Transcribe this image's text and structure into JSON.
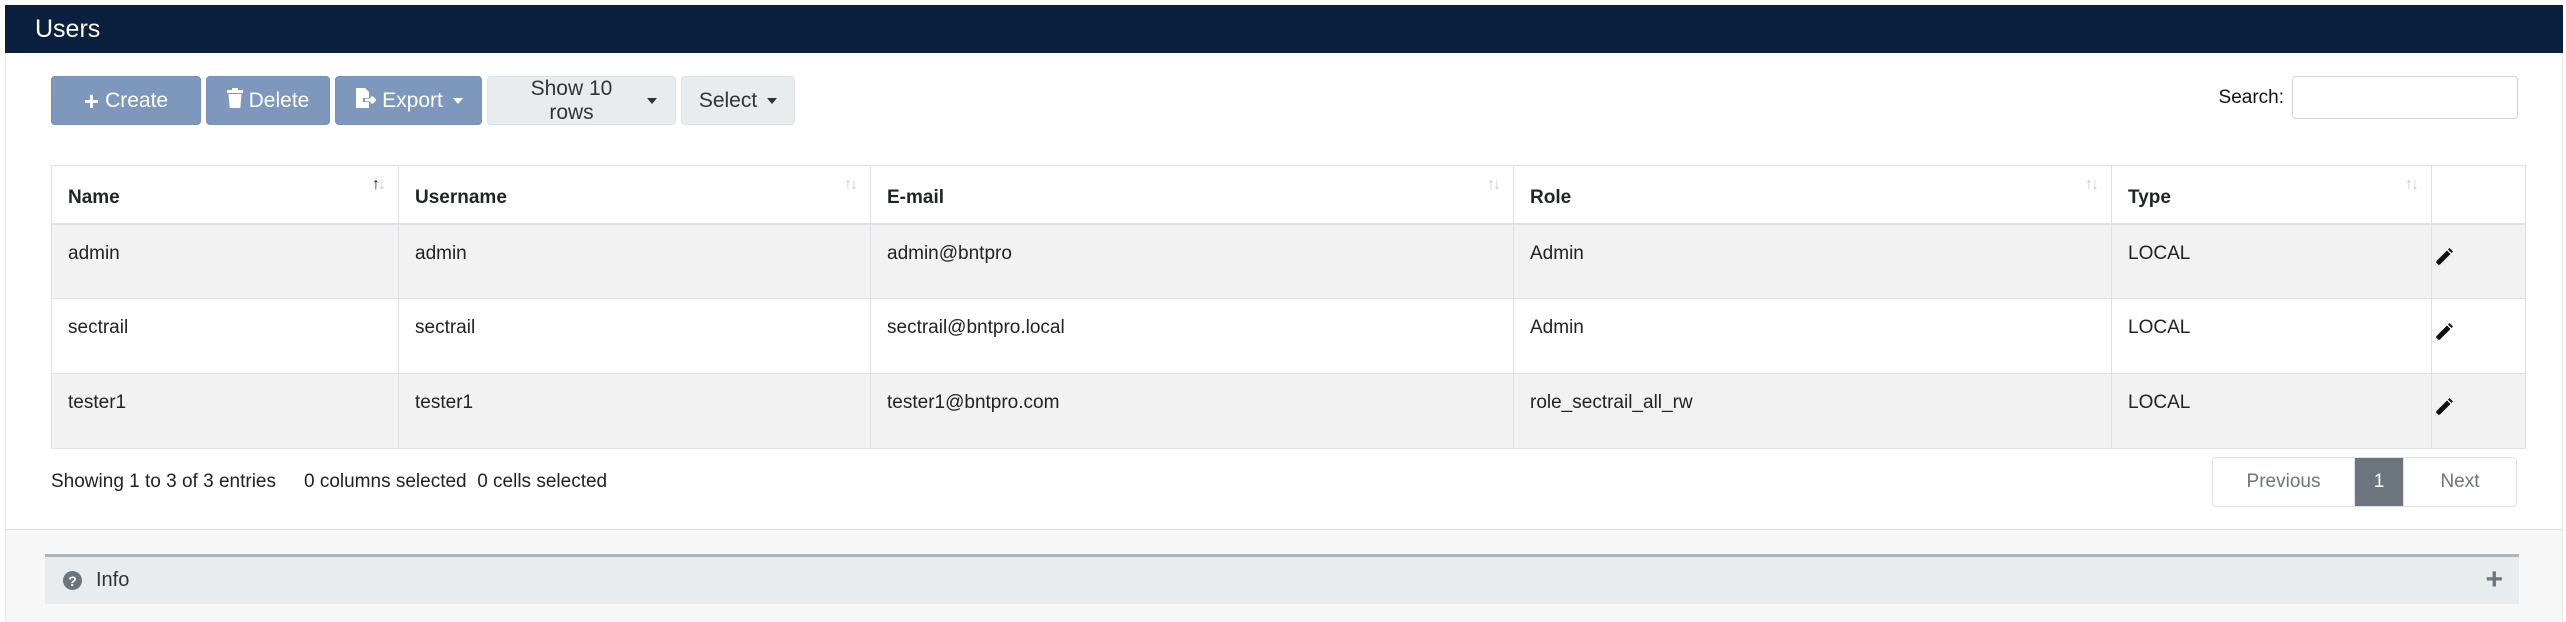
{
  "header": {
    "title": "Users"
  },
  "toolbar": {
    "create_label": "Create",
    "delete_label": "Delete",
    "export_label": "Export",
    "show_rows_label": "Show 10 rows",
    "select_label": "Select"
  },
  "search": {
    "label": "Search:",
    "value": "",
    "placeholder": ""
  },
  "table": {
    "columns": [
      "Name",
      "Username",
      "E-mail",
      "Role",
      "Type"
    ],
    "rows": [
      {
        "name": "admin",
        "username": "admin",
        "email": "admin@bntpro",
        "role": "Admin",
        "type": "LOCAL"
      },
      {
        "name": "sectrail",
        "username": "sectrail",
        "email": "sectrail@bntpro.local",
        "role": "Admin",
        "type": "LOCAL"
      },
      {
        "name": "tester1",
        "username": "tester1",
        "email": "tester1@bntpro.com",
        "role": "role_sectrail_all_rw",
        "type": "LOCAL"
      }
    ]
  },
  "footer": {
    "entries_info": "Showing 1 to 3 of 3 entries",
    "columns_selected": "0 columns selected",
    "cells_selected": "0 cells selected"
  },
  "pagination": {
    "previous": "Previous",
    "current": "1",
    "next": "Next"
  },
  "info_panel": {
    "label": "Info"
  },
  "icons": {
    "create": "plus-icon",
    "delete": "trash-icon",
    "export": "file-export-icon",
    "edit": "pencil-icon",
    "info": "question-circle-icon",
    "expand": "plus-icon"
  },
  "colors": {
    "header_bg": "#0b1f3f",
    "primary_button": "#7e97bd",
    "row_stripe": "#f2f2f2"
  }
}
